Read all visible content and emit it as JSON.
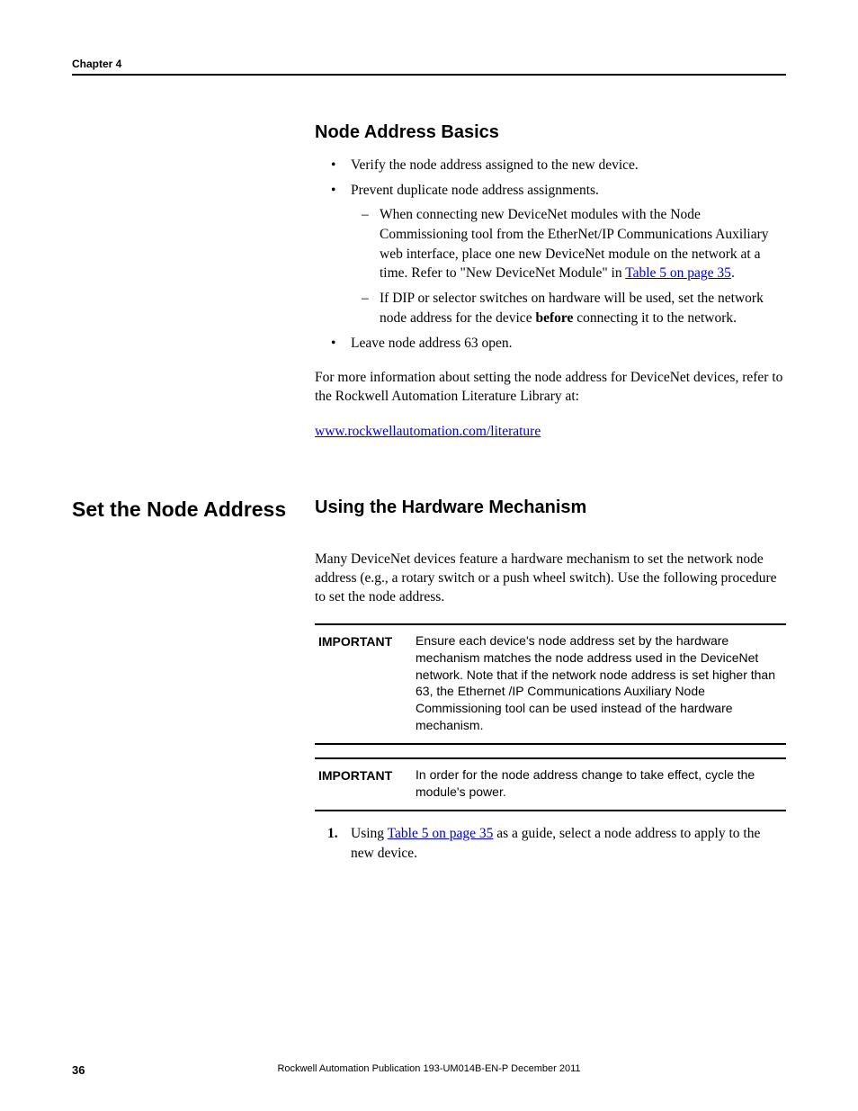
{
  "header": {
    "chapter": "Chapter 4"
  },
  "section1": {
    "title": "Node Address Basics",
    "bullets": {
      "b1": "Verify the node address assigned to the new device.",
      "b2": "Prevent duplicate node address assignments.",
      "sub1_pre": "When connecting new DeviceNet modules with the Node Commissioning tool from the EtherNet/IP Communications Auxiliary web interface, place one new DeviceNet module on the network at a time. Refer to \"New DeviceNet Module\" in ",
      "sub1_link": "Table 5 on page 35",
      "sub1_post": ".",
      "sub2_pre": "If DIP or selector switches on hardware will be used, set the network node address for the device ",
      "sub2_bold": "before",
      "sub2_post": " connecting it to the network.",
      "b3": "Leave node address 63 open."
    },
    "para1": "For more information about setting the node address for DeviceNet devices, refer to the Rockwell Automation Literature Library at:",
    "link1": "www.rockwellautomation.com/literature"
  },
  "section2": {
    "left_title": "Set the Node Address",
    "right_title": "Using the Hardware Mechanism",
    "para1": "Many DeviceNet devices feature a hardware mechanism to set the network node address (e.g., a rotary switch or a push wheel switch). Use the following procedure to set the node address.",
    "important1_label": "IMPORTANT",
    "important1_text": "Ensure each device's node address set by the hardware mechanism matches the node address used in the DeviceNet network. Note that if the network node address is set higher than 63, the Ethernet /IP Communications Auxiliary Node Commissioning tool can be used instead of the hardware mechanism.",
    "important2_label": "IMPORTANT",
    "important2_text": "In order for the node address change to take effect, cycle the module's power.",
    "step1_num": "1.",
    "step1_pre": "Using ",
    "step1_link": "Table 5 on page 35",
    "step1_post": " as a guide, select a node address to apply to the new device."
  },
  "footer": {
    "page": "36",
    "pub": "Rockwell Automation Publication  193-UM014B-EN-P December 2011"
  }
}
